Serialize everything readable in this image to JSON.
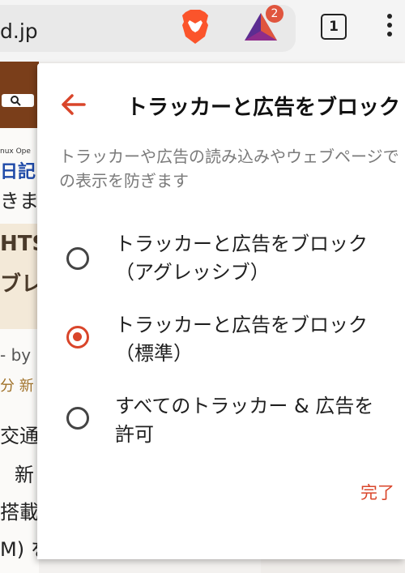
{
  "browser": {
    "url_fragment": "d.jp",
    "tab_count": "1",
    "rewards_badge": "2"
  },
  "background_page": {
    "nav_fragment": "nux Ope",
    "lines": [
      "日記",
      "きま",
      "HTS",
      "ブレ",
      "- by",
      "分 新",
      "交通",
      "新",
      "搭載",
      "M) を"
    ]
  },
  "dialog": {
    "title": "トラッカーと広告をブロック",
    "description": "トラッカーや広告の読み込みやウェブページでの表示を防ぎます",
    "options": [
      {
        "label": "トラッカーと広告をブロック\n（アグレッシブ）",
        "selected": false
      },
      {
        "label": "トラッカーと広告をブロック\n（標準）",
        "selected": true
      },
      {
        "label": "すべてのトラッカー & 広告を\n許可",
        "selected": false
      }
    ],
    "done_label": "完了"
  },
  "colors": {
    "accent": "#d9452a",
    "brave_orange": "#fb542b"
  }
}
